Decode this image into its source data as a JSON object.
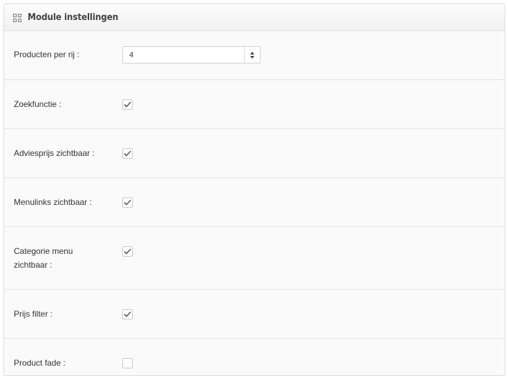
{
  "panel": {
    "title": "Module instellingen",
    "icon": "grid-icon"
  },
  "settings": {
    "producten_per_rij": {
      "label": "Producten per rij :",
      "value": "4"
    },
    "zoekfunctie": {
      "label": "Zoekfunctie :",
      "checked": true
    },
    "adviesprijs": {
      "label": "Adviesprijs zichtbaar :",
      "checked": true
    },
    "menulinks": {
      "label": "Menulinks zichtbaar :",
      "checked": true
    },
    "categorie_menu": {
      "label_line1": "Categorie menu",
      "label_line2": "zichtbaar :",
      "checked": true
    },
    "prijs_filter": {
      "label": "Prijs filter :",
      "checked": true
    },
    "product_fade": {
      "label": "Product fade :",
      "checked": false
    }
  }
}
